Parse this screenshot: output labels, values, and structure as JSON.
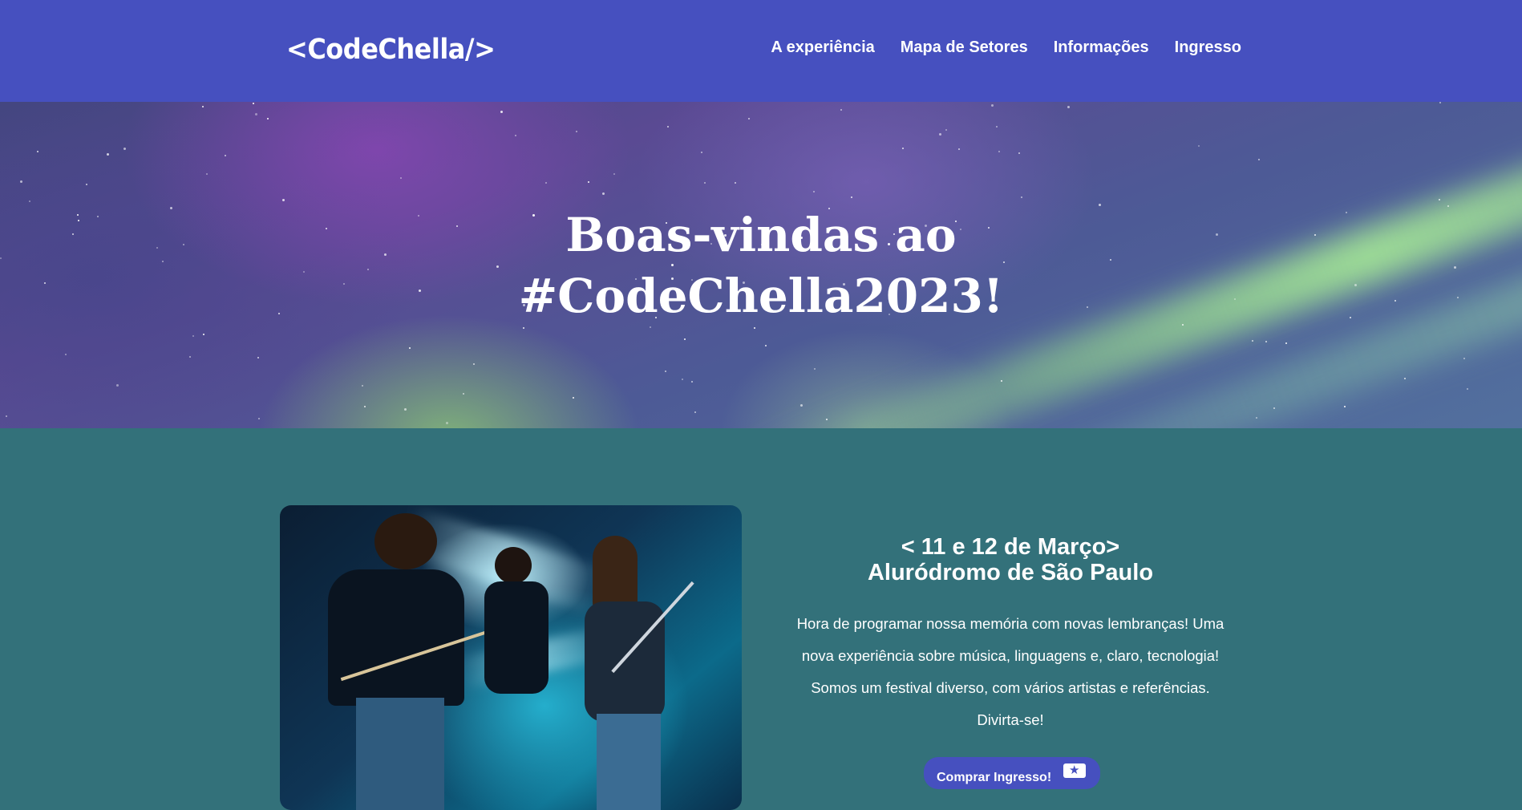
{
  "header": {
    "logo": "<CodeChella/>",
    "nav": [
      {
        "label": "A experiência"
      },
      {
        "label": "Mapa de Setores"
      },
      {
        "label": "Informações"
      },
      {
        "label": "Ingresso"
      }
    ]
  },
  "hero": {
    "title_line1": "Boas-vindas ao",
    "title_line2": "#CodeChella2023!"
  },
  "info": {
    "date": "< 11 e 12 de Março>",
    "place": "Aluródromo de São Paulo",
    "description": "Hora de programar nossa memória com novas lembranças! Uma nova experiência sobre música, linguagens e, claro, tecnologia! Somos um festival diverso, com vários artistas e referências. Divirta-se!",
    "button_label": "Comprar Ingresso!",
    "button_icon": "ticket-icon"
  },
  "colors": {
    "header_bg": "#4650bf",
    "section_bg": "#33717a",
    "button_bg": "#4650bf",
    "text": "#ffffff"
  }
}
